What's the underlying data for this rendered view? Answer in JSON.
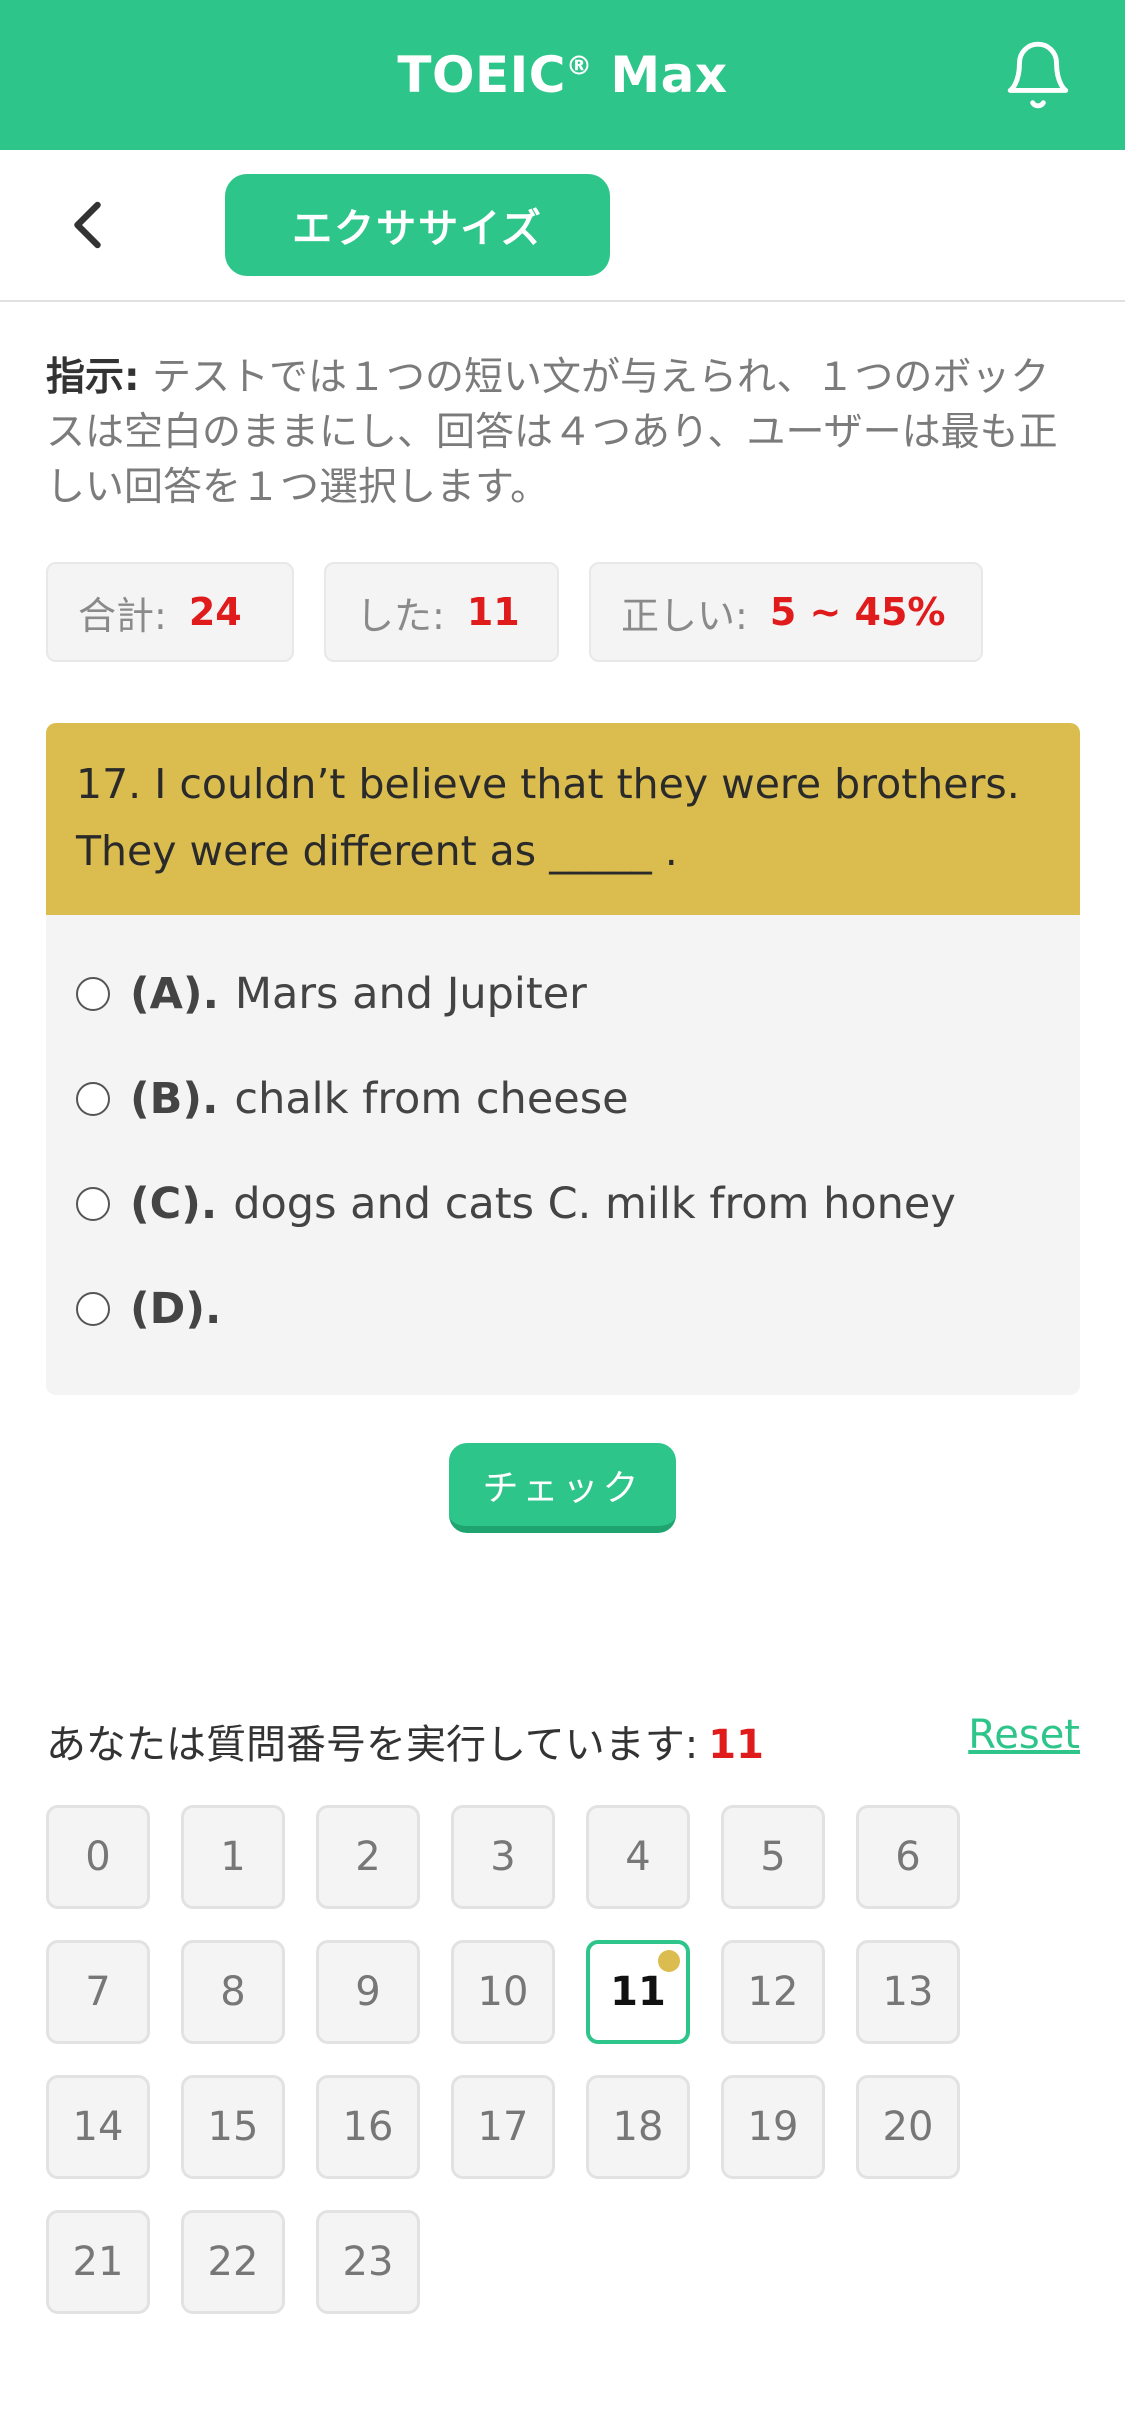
{
  "header": {
    "title": "TOEIC",
    "title_mark": "®",
    "title_suffix": "Max",
    "bell_icon": "bell-icon"
  },
  "subbar": {
    "back_icon": "chevron-left-icon",
    "tab_label": "エクササイズ"
  },
  "instructions": {
    "label": "指示:",
    "text": "テストでは１つの短い文が与えられ、１つのボックスは空白のままにし、回答は４つあり、ユーザーは最も正しい回答を１つ選択します。"
  },
  "stats": {
    "total_label": "合計:",
    "total_value": "24",
    "done_label": "した:",
    "done_value": "11",
    "correct_label": "正しい:",
    "correct_value": "5 ~ 45%"
  },
  "question": {
    "line1": "17. I couldn’t believe that they were brothers.",
    "line2": "They were different as _____ ."
  },
  "options": [
    {
      "letter": "(A).",
      "text": "Mars and Jupiter"
    },
    {
      "letter": "(B).",
      "text": "chalk from cheese"
    },
    {
      "letter": "(C).",
      "text": "dogs and cats C. milk from honey"
    },
    {
      "letter": "(D).",
      "text": ""
    }
  ],
  "check_label": "チェック",
  "progress": {
    "label": "あなたは質問番号を実行しています:",
    "current": "11",
    "reset_label": "Reset"
  },
  "numbers": [
    "0",
    "1",
    "2",
    "3",
    "4",
    "5",
    "6",
    "7",
    "8",
    "9",
    "10",
    "11",
    "12",
    "13",
    "14",
    "15",
    "16",
    "17",
    "18",
    "19",
    "20",
    "21",
    "22",
    "23"
  ],
  "active_number": "11",
  "colors": {
    "brand_green": "#2ec58a",
    "question_yellow": "#dbbd4f",
    "accent_red": "#e01b1b"
  }
}
